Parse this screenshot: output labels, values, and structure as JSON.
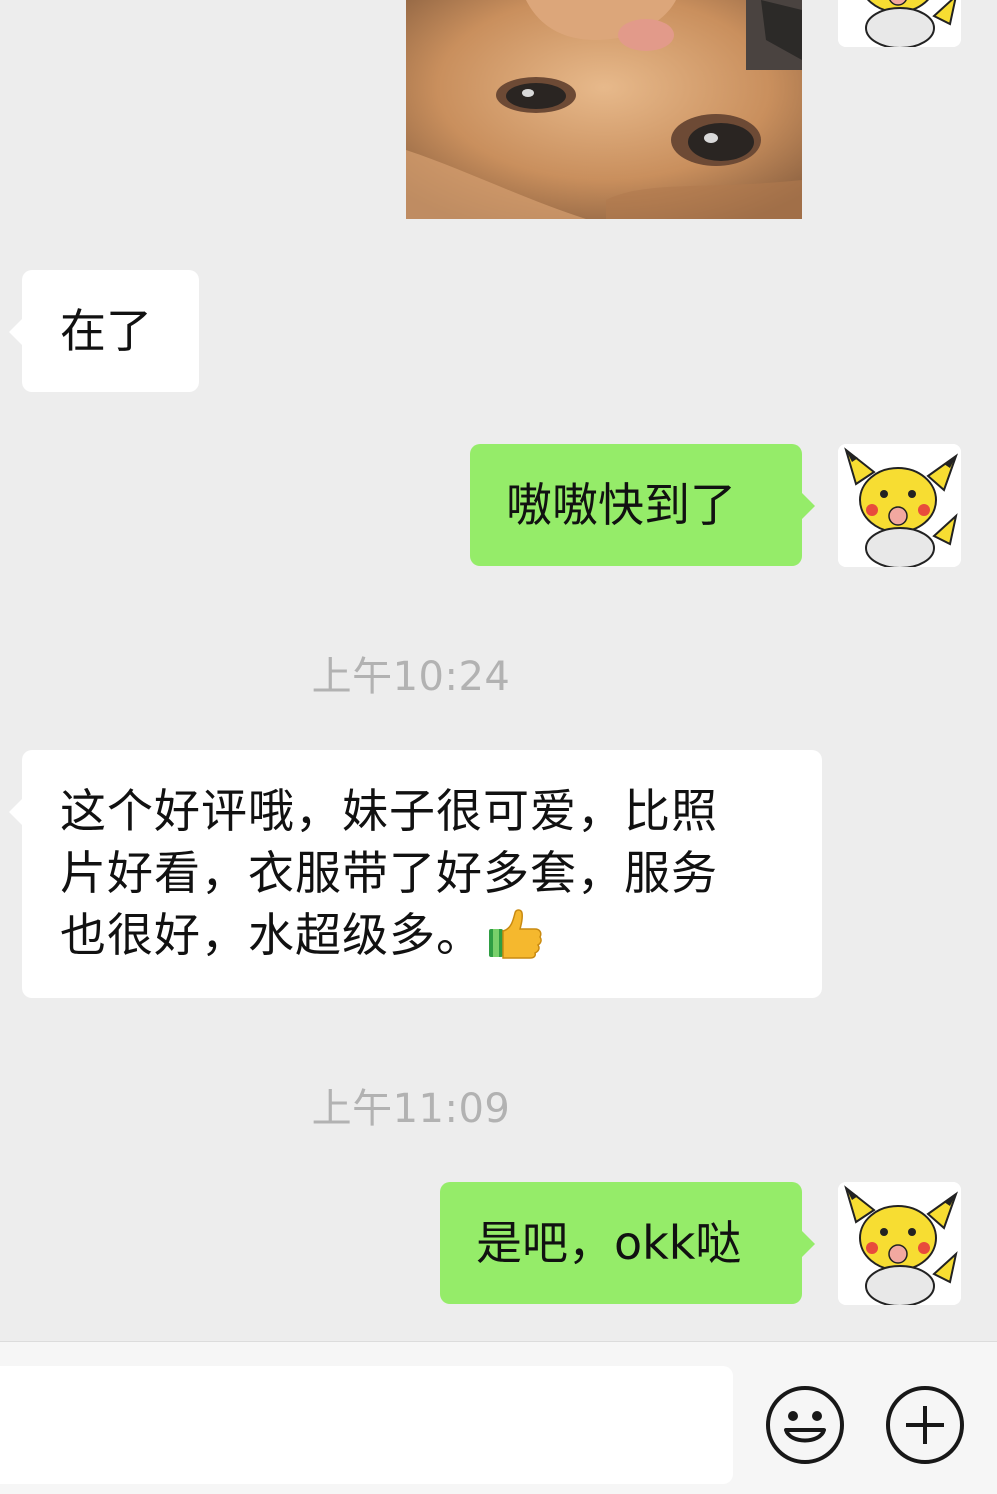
{
  "messages": [
    {
      "side": "left",
      "text": "在了"
    },
    {
      "side": "right",
      "text": "嗷嗷快到了"
    },
    {
      "side": "left",
      "lines": [
        "这个好评哦，妹子很可爱，比照",
        "片好看，衣服带了好多套，服务",
        "也很好，水超级多。"
      ],
      "trailing_emoji": "thumbs-up-icon"
    },
    {
      "side": "right",
      "text": "是吧，okk哒"
    }
  ],
  "timestamps": [
    "上午10:24",
    "上午11:09"
  ],
  "colors": {
    "background": "#ededed",
    "outgoing_bubble": "#95ec69",
    "incoming_bubble": "#ffffff",
    "timestamp_text": "#b2b2b2"
  },
  "input_bar": {
    "value": "",
    "icons": [
      "emoji-face-icon",
      "plus-circle-icon"
    ]
  }
}
